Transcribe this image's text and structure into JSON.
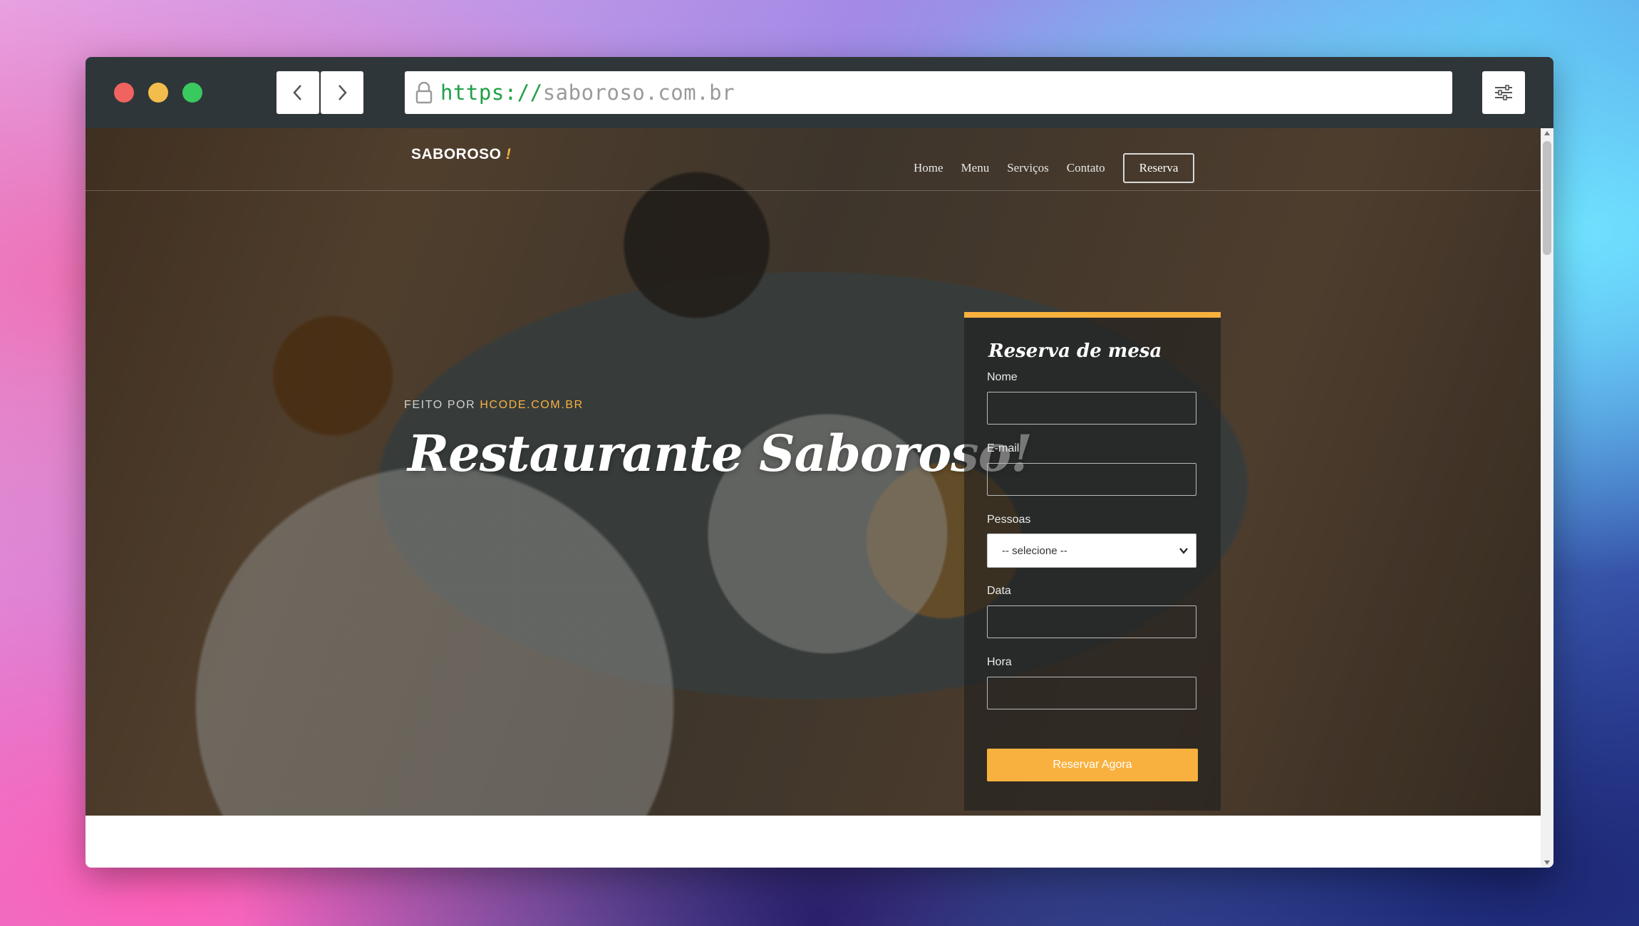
{
  "browser": {
    "url_protocol": "https://",
    "url_host": "saboroso.com.br"
  },
  "site": {
    "brand": "SABOROSO",
    "brand_mark": "!",
    "nav": [
      {
        "label": "Home"
      },
      {
        "label": "Menu"
      },
      {
        "label": "Serviços"
      },
      {
        "label": "Contato"
      }
    ],
    "reserve_button": "Reserva"
  },
  "hero": {
    "made_by_prefix": "FEITO POR",
    "made_by_link": "HCODE.COM.BR",
    "title": "Restaurante Saboroso!"
  },
  "reservation_form": {
    "title": "Reserva de mesa",
    "name_label": "Nome",
    "email_label": "E-mail",
    "people_label": "Pessoas",
    "people_selected": "-- selecione --",
    "date_label": "Data",
    "time_label": "Hora",
    "submit_label": "Reservar Agora"
  },
  "colors": {
    "accent": "#f8b13e",
    "chrome": "#2f3639",
    "url_protocol": "#1fa045"
  },
  "icons": [
    "back-arrow-icon",
    "forward-arrow-icon",
    "lock-icon",
    "sliders-icon",
    "chevron-down-icon"
  ]
}
